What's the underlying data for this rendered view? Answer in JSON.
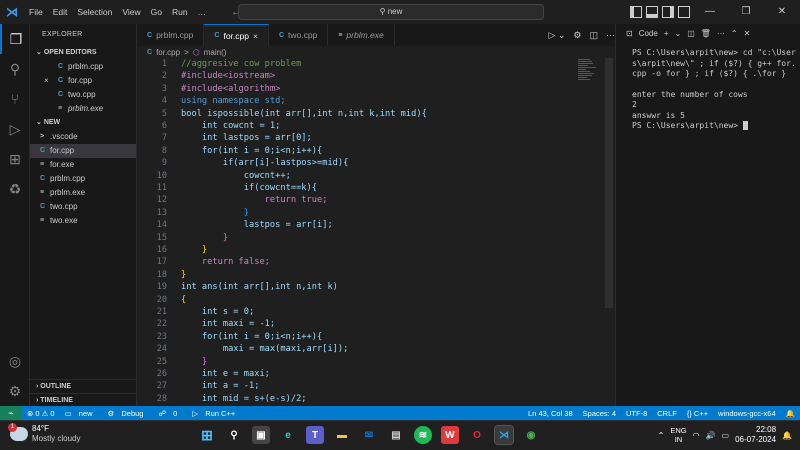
{
  "titlebar": {
    "menu": [
      "File",
      "Edit",
      "Selection",
      "View",
      "Go",
      "Run",
      "…"
    ],
    "search": "new"
  },
  "sidebar": {
    "header": "EXPLORER",
    "open_editors_label": "OPEN EDITORS",
    "open_editors": [
      {
        "icon": "C",
        "name": "prblm.cpp",
        "selected": false
      },
      {
        "icon": "C",
        "name": "for.cpp",
        "selected": false,
        "close": "×"
      },
      {
        "icon": "C",
        "name": "two.cpp",
        "selected": false
      },
      {
        "icon": "≡",
        "name": "prblm.exe",
        "selected": false
      }
    ],
    "folder_label": "NEW",
    "files": [
      {
        "icon": ">",
        "name": ".vscode",
        "selected": false
      },
      {
        "icon": "C",
        "name": "for.cpp",
        "selected": true
      },
      {
        "icon": "≡",
        "name": "for.exe",
        "selected": false
      },
      {
        "icon": "C",
        "name": "prblm.cpp",
        "selected": false
      },
      {
        "icon": "≡",
        "name": "prblm.exe",
        "selected": false
      },
      {
        "icon": "C",
        "name": "two.cpp",
        "selected": false
      },
      {
        "icon": "≡",
        "name": "two.exe",
        "selected": false
      }
    ],
    "outline_label": "OUTLINE",
    "timeline_label": "TIMELINE"
  },
  "tabs": [
    {
      "name": "prblm.cpp",
      "active": false
    },
    {
      "name": "for.cpp",
      "active": true,
      "close": "×"
    },
    {
      "name": "two.cpp",
      "active": false
    },
    {
      "name": "prblm.exe",
      "active": false
    }
  ],
  "breadcrumb": {
    "file": "for.cpp",
    "sep": ">",
    "symbol": "main()"
  },
  "code": {
    "line_numbers": [
      "1",
      "2",
      "3",
      "4",
      "5",
      "6",
      "7",
      "8",
      "9",
      "10",
      "11",
      "12",
      "13",
      "14",
      "15",
      "16",
      "17",
      "18",
      "19",
      "20",
      "21",
      "22",
      "23",
      "24",
      "25",
      "26",
      "27",
      "28"
    ],
    "lines": [
      "//aggresive cow problem",
      "#include<iostream>",
      "#include<algorithm>",
      "using namespace std;",
      "bool ispossible(int arr[],int n,int k,int mid){",
      "    int cowcnt = 1;",
      "    int lastpos = arr[0];",
      "    for(int i = 0;i<n;i++){",
      "        if(arr[i]-lastpos>=mid){",
      "            cowcnt++;",
      "            if(cowcnt==k){",
      "                return true;",
      "            }",
      "            lastpos = arr[i];",
      "        }",
      "    }",
      "    return false;",
      "}",
      "int ans(int arr[],int n,int k)",
      "{",
      "    int s = 0;",
      "    int maxi = -1;",
      "    for(int i = 0;i<n;i++){",
      "        maxi = max(maxi,arr[i]);",
      "    }",
      "    int e = maxi;",
      "    int a = -1;",
      "    int mid = s+(e-s)/2;"
    ]
  },
  "terminal": {
    "tab_label": "Code",
    "lines": [
      "PS C:\\Users\\arpit\\new> cd \"c:\\Users\\arpit\\new\\\" ; if ($?) { g++ for.cpp -o for } ; if ($?) { .\\for }",
      "enter the number of cows",
      "2",
      "answwr is 5",
      "PS C:\\Users\\arpit\\new> "
    ]
  },
  "statusbar": {
    "remote": "⌁",
    "errors": "⊗ 0 ⚠ 0",
    "folder": "new",
    "debug": "Debug",
    "ports": "0",
    "run": "Run C++",
    "position": "Ln 43, Col 38",
    "spaces": "Spaces: 4",
    "encoding": "UTF-8",
    "eol": "CRLF",
    "language": "{} C++",
    "platform": "windows-gcc-x64"
  },
  "taskbar": {
    "weather_badge": "1",
    "temp": "84°F",
    "condition": "Mostly cloudy",
    "lang_top": "ENG",
    "lang_bottom": "IN",
    "time": "22:08",
    "date": "06-07-2024"
  },
  "colors": {
    "accent": "#007acc",
    "explorer_selected": "#37373d"
  }
}
